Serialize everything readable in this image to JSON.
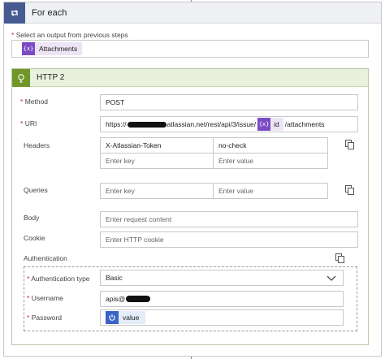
{
  "foreach": {
    "title": "For each",
    "select_label": "Select an output from previous steps",
    "required_mark": "*",
    "token": "Attachments",
    "token_icon": "{x}"
  },
  "http": {
    "title": "HTTP 2",
    "method_label": "Method",
    "method_value": "POST",
    "uri_label": "URI",
    "uri_prefix": "https://",
    "uri_middle": "atlassian.net/rest/api/3/issue/",
    "uri_token": "id",
    "uri_suffix": "/attachments",
    "headers_label": "Headers",
    "headers_rows": [
      {
        "key": "X-Atlassian-Token",
        "value": "no-check"
      },
      {
        "key": "Enter key",
        "value": "Enter value"
      }
    ],
    "queries_label": "Queries",
    "queries_key_placeholder": "Enter key",
    "queries_value_placeholder": "Enter value",
    "body_label": "Body",
    "body_placeholder": "Enter request content",
    "cookie_label": "Cookie",
    "cookie_placeholder": "Enter HTTP cookie",
    "auth_label": "Authentication",
    "auth_type_label": "Authentication type",
    "auth_type_value": "Basic",
    "username_label": "Username",
    "username_value": "apis@",
    "password_label": "Password",
    "password_token": "value"
  },
  "colors": {
    "foreach_accent": "#455a91",
    "http_accent": "#709727",
    "token_accent": "#7c4ac5",
    "required": "#c4262e"
  }
}
